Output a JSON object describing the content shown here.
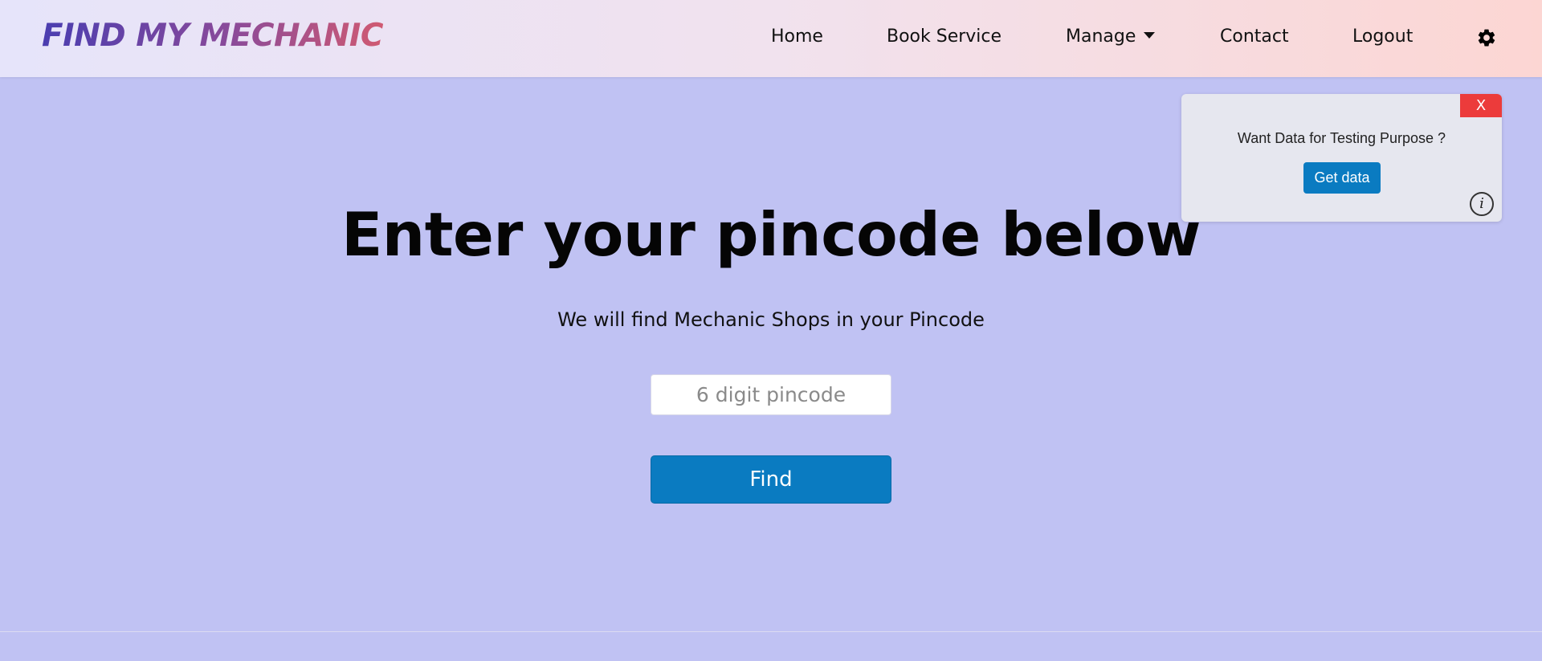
{
  "brand": {
    "title": "FIND MY MECHANIC"
  },
  "nav": {
    "home": "Home",
    "book_service": "Book Service",
    "manage": "Manage",
    "contact": "Contact",
    "logout": "Logout",
    "theme_icon": "gear-icon"
  },
  "hero": {
    "title": "Enter your pincode below",
    "subtitle": "We will find Mechanic Shops in your Pincode",
    "pincode_placeholder": "6 digit pincode",
    "find_label": "Find"
  },
  "popup": {
    "close_label": "X",
    "message": "Want Data for Testing Purpose ?",
    "button_label": "Get data",
    "info_label": "i"
  },
  "colors": {
    "page_background": "#c0c2f3",
    "primary_button": "#0a7bc1",
    "close_button": "#ec3b3b"
  }
}
